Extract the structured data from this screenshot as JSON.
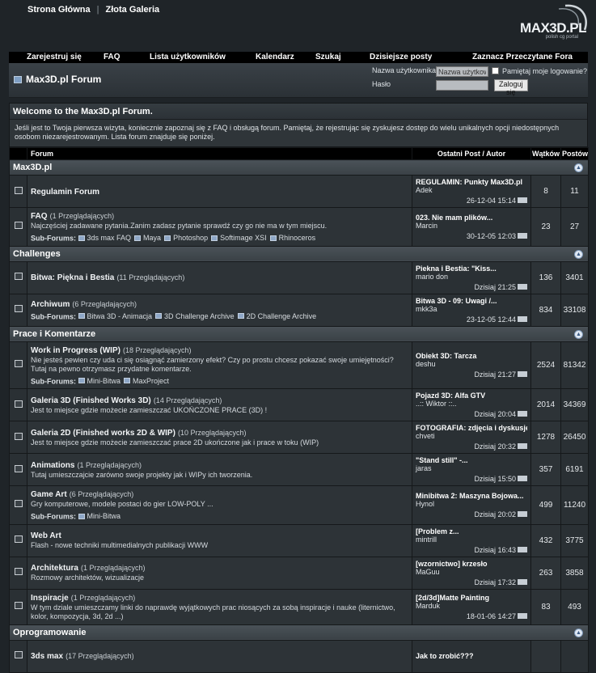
{
  "top_links": [
    "Strona Główna",
    "Złota Galeria"
  ],
  "logo": {
    "wordmark": "MAX3D.PL",
    "tagline": "polish cg portal"
  },
  "nav": [
    "Zarejestruj się",
    "FAQ",
    "Lista użytkowników",
    "Kalendarz",
    "Szukaj",
    "Dzisiejsze posty",
    "Zaznacz Przeczytane Fora"
  ],
  "forum_title": "Max3D.pl Forum",
  "login": {
    "username_label": "Nazwa użytkownika",
    "username_placeholder": "Nazwa użytkown",
    "remember_label": "Pamiętaj moje logowanie?",
    "password_label": "Hasło",
    "submit_label": "Zaloguj się"
  },
  "welcome": {
    "title": "Welcome to the Max3D.pl Forum.",
    "text": "Jeśli jest to Twoja pierwsza wizyta, koniecznie zapoznaj się z FAQ i obsługą forum. Pamiętaj, że rejestrując się zyskujesz dostęp do wielu unikalnych opcji niedostępnych osobom niezarejestrowanym. Lista forum znajduje się poniżej."
  },
  "columns": {
    "forum": "Forum",
    "last": "Ostatni Post / Autor",
    "threads": "Wątków",
    "posts": "Postów"
  },
  "categories": [
    {
      "name": "Max3D.pl",
      "forums": [
        {
          "name": "Regulamin Forum",
          "viewers": "",
          "desc": "",
          "subs": [],
          "last_title": "REGULAMIN: Punkty Max3D.pl",
          "last_author": "Adek",
          "last_date": "26-12-04",
          "last_time": "15:14",
          "threads": "8",
          "posts": "11"
        },
        {
          "name": "FAQ",
          "viewers": "(1 Przeglądających)",
          "desc": "Najczęściej zadawane pytania.Zanim zadasz pytanie sprawdź czy go nie ma w tym miejscu.",
          "subs": [
            "3ds max FAQ",
            "Maya",
            "Photoshop",
            "Softimage XSI",
            "Rhinoceros"
          ],
          "last_title": "023. Nie mam plików...",
          "last_author": "Marcin",
          "last_date": "30-12-05",
          "last_time": "12:03",
          "threads": "23",
          "posts": "27"
        }
      ]
    },
    {
      "name": "Challenges",
      "forums": [
        {
          "name": "Bitwa: Piękna i Bestia",
          "viewers": "(11 Przeglądających)",
          "desc": "",
          "subs": [],
          "last_title": "Piekna i Bestia: \"Kiss...",
          "last_author": "mario don",
          "last_date": "Dzisiaj",
          "last_time": "21:25",
          "threads": "136",
          "posts": "3401"
        },
        {
          "name": "Archiwum",
          "viewers": "(6 Przeglądających)",
          "desc": "",
          "subs": [
            "Bitwa 3D - Animacja",
            "3D Challenge Archive",
            "2D Challenge Archive"
          ],
          "last_title": "Bitwa 3D - 09: Uwagi /...",
          "last_author": "mkk3a",
          "last_date": "23-12-05",
          "last_time": "12:44",
          "threads": "834",
          "posts": "33108"
        }
      ]
    },
    {
      "name": "Prace i Komentarze",
      "forums": [
        {
          "name": "Work in Progress (WIP)",
          "viewers": "(18 Przeglądających)",
          "desc": "Nie jesteś pewien czy uda ci się osiągnąć zamierzony efekt? Czy po prostu chcesz pokazać swoje umiejętności? Tutaj na pewno otrzymasz przydatne komentarze.",
          "subs": [
            "Mini-Bitwa",
            "MaxProject"
          ],
          "last_title": "Obiekt 3D: Tarcza",
          "last_author": "deshu",
          "last_date": "Dzisiaj",
          "last_time": "21:27",
          "threads": "2524",
          "posts": "81342"
        },
        {
          "name": "Galeria 3D (Finished Works 3D)",
          "viewers": "(14 Przeglądających)",
          "desc": "Jest to miejsce gdzie możecie zamieszczać UKOŃCZONE PRACE (3D) !",
          "subs": [],
          "last_title": "Pojazd 3D: Alfa GTV",
          "last_author": "..:: Wiktor ::..",
          "last_date": "Dzisiaj",
          "last_time": "20:04",
          "threads": "2014",
          "posts": "34369"
        },
        {
          "name": "Galeria 2D (Finished works 2D & WIP)",
          "viewers": "(10 Przeglądających)",
          "desc": "Jest to miejsce gdzie możecie zamieszczać prace 2D ukończone jak i prace w toku (WIP)",
          "subs": [],
          "last_title": "FOTOGRAFIA: zdjęcia i dyskusje",
          "last_author": "chveti",
          "last_date": "Dzisiaj",
          "last_time": "20:32",
          "threads": "1278",
          "posts": "26450"
        },
        {
          "name": "Animations",
          "viewers": "(1 Przeglądających)",
          "desc": "Tutaj umieszczajcie zarówno swoje projekty jak i WIPy ich tworzenia.",
          "subs": [],
          "last_title": "\"Stand still\" -...",
          "last_author": "jaras",
          "last_date": "Dzisiaj",
          "last_time": "15:50",
          "threads": "357",
          "posts": "6191"
        },
        {
          "name": "Game Art",
          "viewers": "(6 Przeglądających)",
          "desc": "Gry komputerowe, modele postaci do gier LOW-POLY ...",
          "subs": [
            "Mini-Bitwa"
          ],
          "last_title": "Minibitwa 2: Maszyna Bojowa...",
          "last_author": "Hynol",
          "last_date": "Dzisiaj",
          "last_time": "20:02",
          "threads": "499",
          "posts": "11240"
        },
        {
          "name": "Web Art",
          "viewers": "",
          "desc": "Flash - nowe techniki multimedialnych publikacji WWW",
          "subs": [],
          "last_title": "[Problem z...",
          "last_author": "mintrill",
          "last_date": "Dzisiaj",
          "last_time": "16:43",
          "threads": "432",
          "posts": "3775"
        },
        {
          "name": "Architektura",
          "viewers": "(1 Przeglądających)",
          "desc": "Rozmowy architektów, wizualizacje",
          "subs": [],
          "last_title": "[wzornictwo] krzesło",
          "last_author": "MaGuu",
          "last_date": "Dzisiaj",
          "last_time": "17:32",
          "threads": "263",
          "posts": "3858"
        },
        {
          "name": "Inspiracje",
          "viewers": "(1 Przeglądających)",
          "desc": "W tym dziale umieszczamy linki do naprawdę wyjątkowych prac niosących za sobą inspiracje i nauke (liternictwo, kolor, kompozycja, 3d, 2d ...)",
          "subs": [],
          "last_title": "[2d/3d]Matte Painting",
          "last_author": "Marduk",
          "last_date": "18-01-06",
          "last_time": "14:27",
          "threads": "83",
          "posts": "493"
        }
      ]
    },
    {
      "name": "Oprogramowanie",
      "forums": [
        {
          "name": "3ds max",
          "viewers": "(17 Przeglądających)",
          "desc": "",
          "subs": [],
          "last_title": "Jak to zrobić???",
          "last_author": "",
          "last_date": "",
          "last_time": "",
          "threads": "",
          "posts": ""
        }
      ]
    }
  ],
  "icons": {
    "forum": "folder-icon",
    "collapse": "collapse-icon",
    "last_post": "go-to-last-post-icon",
    "subforum": "subforum-icon"
  }
}
